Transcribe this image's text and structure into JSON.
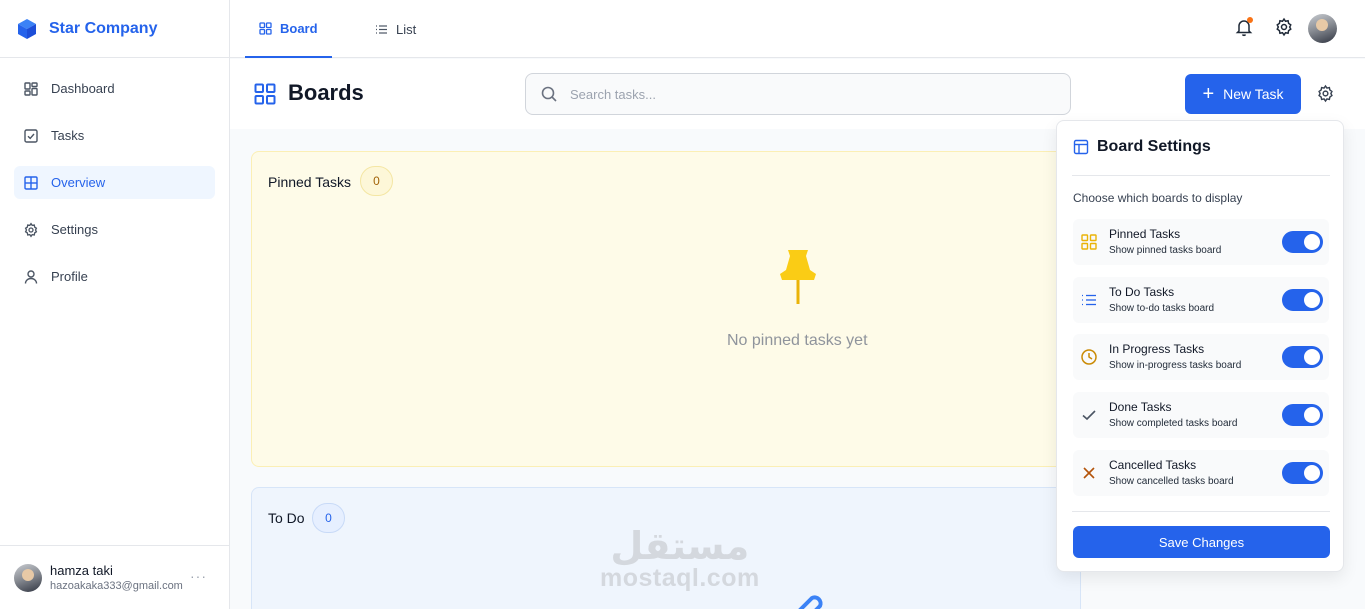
{
  "app": {
    "name": "Star Company",
    "logo_icon": "cube-icon",
    "accent_color": "#2563eb"
  },
  "sidebar": {
    "items": [
      {
        "label": "Dashboard",
        "icon": "dashboard-icon",
        "active": false
      },
      {
        "label": "Tasks",
        "icon": "checkbox-icon",
        "active": false
      },
      {
        "label": "Overview",
        "icon": "table-icon",
        "active": true
      },
      {
        "label": "Settings",
        "icon": "gear-icon",
        "active": false
      },
      {
        "label": "Profile",
        "icon": "user-icon",
        "active": false
      }
    ],
    "user": {
      "name": "hamza taki",
      "email": "hazoakaka333@gmail.com",
      "more": "···"
    }
  },
  "topbar": {
    "tabs": [
      {
        "label": "Board",
        "icon": "grid-icon",
        "active": true
      },
      {
        "label": "List",
        "icon": "list-icon",
        "active": false
      }
    ],
    "notification_dot_color": "#f97316"
  },
  "header": {
    "title": "Boards",
    "search_placeholder": "Search tasks...",
    "new_task_label": "New Task"
  },
  "boards": {
    "pinned": {
      "title": "Pinned Tasks",
      "count": "0",
      "empty_text": "No pinned tasks yet"
    },
    "todo": {
      "title": "To Do",
      "count": "0"
    }
  },
  "watermark": {
    "arabic": "مستقل",
    "latin": "mostaql.com"
  },
  "settings_panel": {
    "title": "Board Settings",
    "subtitle": "Choose which boards to display",
    "options": [
      {
        "label": "Pinned Tasks",
        "desc": "Show pinned tasks board",
        "icon": "grid-icon",
        "color": "#eab308",
        "enabled": true
      },
      {
        "label": "To Do Tasks",
        "desc": "Show to-do tasks board",
        "icon": "list-icon",
        "color": "#2563eb",
        "enabled": true
      },
      {
        "label": "In Progress Tasks",
        "desc": "Show in-progress tasks board",
        "icon": "clock-icon",
        "color": "#ca8a04",
        "enabled": true
      },
      {
        "label": "Done Tasks",
        "desc": "Show completed tasks board",
        "icon": "check-icon",
        "color": "#4b5563",
        "enabled": true
      },
      {
        "label": "Cancelled Tasks",
        "desc": "Show cancelled tasks board",
        "icon": "x-icon",
        "color": "#b45309",
        "enabled": true
      }
    ],
    "save_label": "Save Changes"
  }
}
